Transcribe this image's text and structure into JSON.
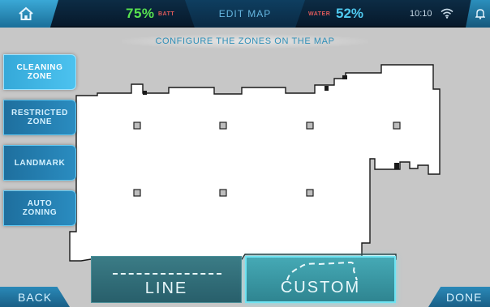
{
  "colors": {
    "accent": "#2a8cc0",
    "battery": "#58e34f",
    "water": "#4fc9ef",
    "status_label": "#e05a5a",
    "map_free": "#ffffff",
    "map_background": "#c7c7c7"
  },
  "header": {
    "home_icon": "home-icon",
    "battery_percent": "75%",
    "battery_label": "BATT",
    "title": "EDIT MAP",
    "water_label": "WATER",
    "water_percent": "52%",
    "time": "10:10",
    "wifi_icon": "wifi-icon",
    "bell_icon": "bell-icon"
  },
  "instruction": "CONFIGURE THE ZONES ON THE MAP",
  "sidebar": {
    "items": [
      {
        "label": "CLEANING\nZONE"
      },
      {
        "label": "RESTRICTED\nZONE"
      },
      {
        "label": "LANDMARK"
      },
      {
        "label": "AUTO\nZONING"
      }
    ]
  },
  "modes": {
    "line_label": "LINE",
    "custom_label": "CUSTOM",
    "selected": "CUSTOM"
  },
  "footer": {
    "back_label": "BACK",
    "done_label": "DONE"
  }
}
